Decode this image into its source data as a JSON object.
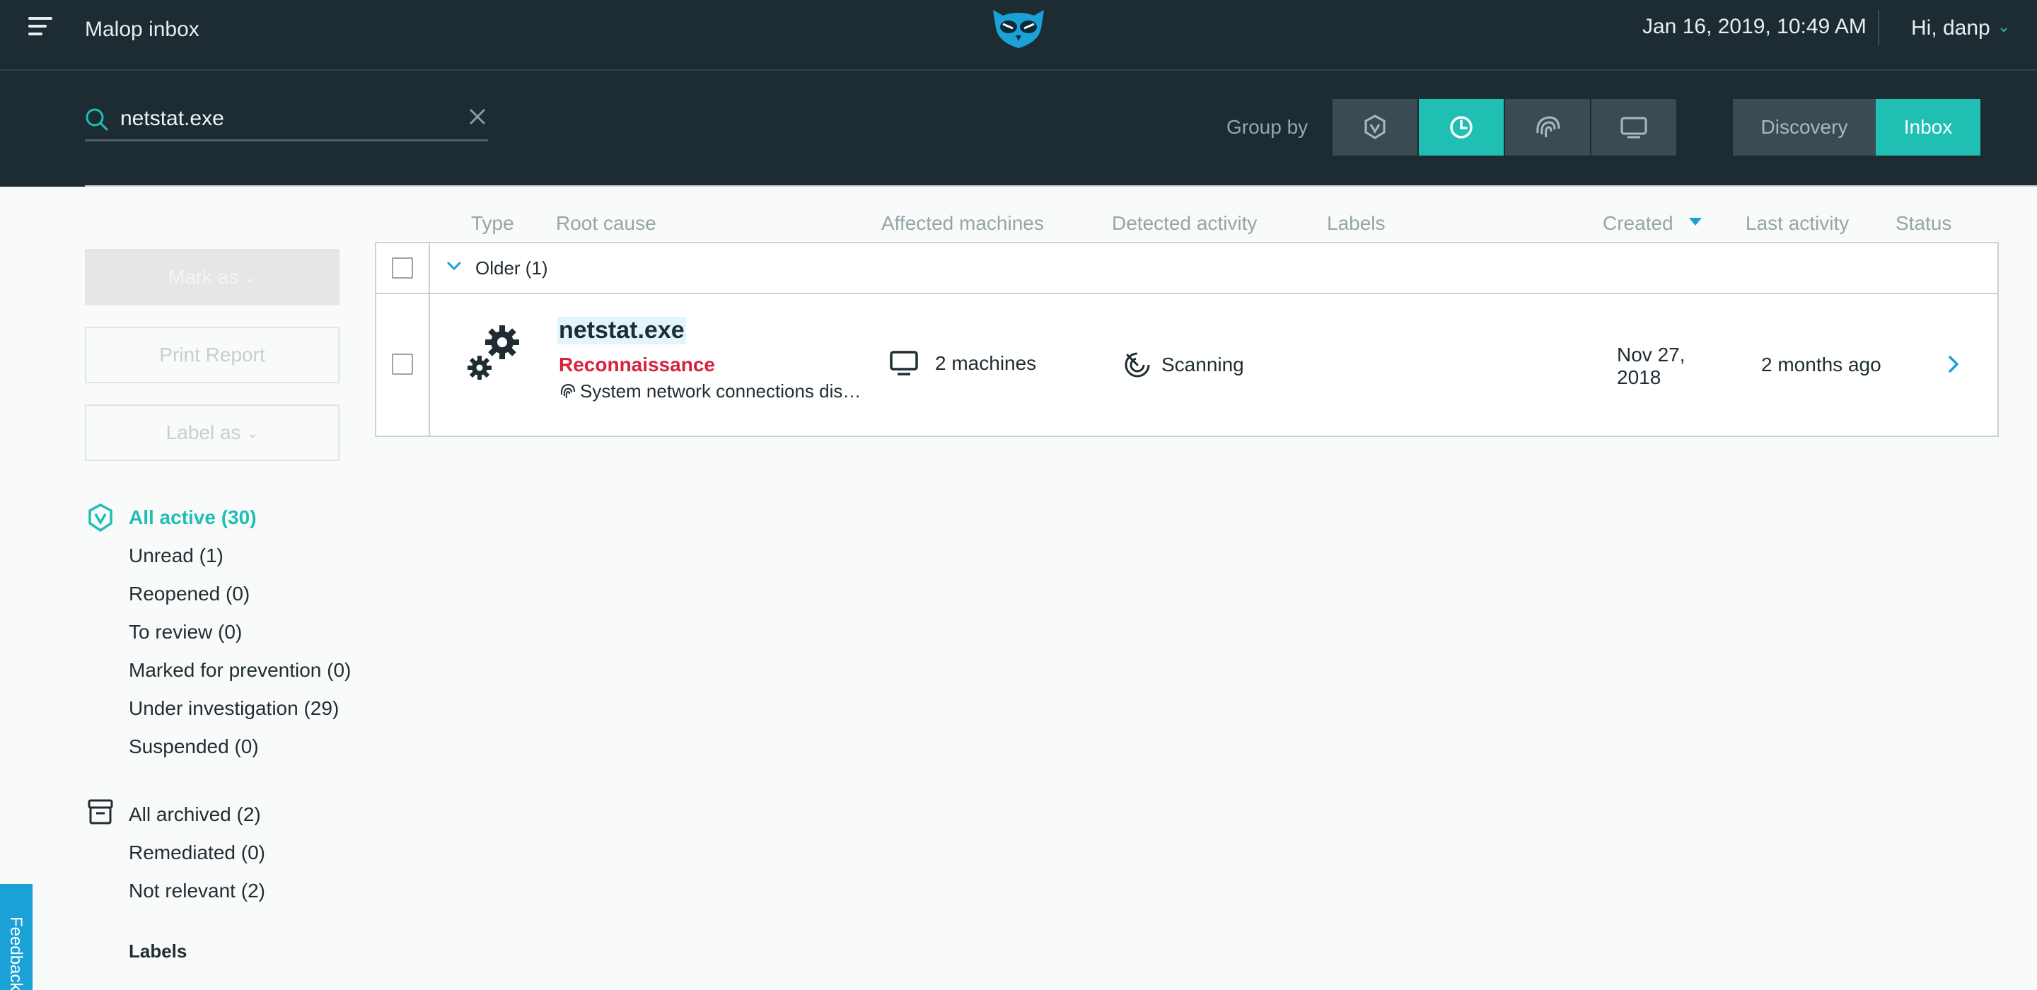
{
  "header": {
    "title": "Malop inbox",
    "datetime": "Jan 16, 2019, 10:49 AM",
    "user_greeting": "Hi, danp",
    "menu_icon": "hamburger-menu-icon",
    "logo": "owl-logo"
  },
  "search": {
    "value": "netstat.exe",
    "icon": "search-icon",
    "clear_icon": "close-icon"
  },
  "groupby": {
    "label": "Group by",
    "options": [
      {
        "icon": "malop-hex-icon",
        "active": false
      },
      {
        "icon": "clock-icon",
        "active": true
      },
      {
        "icon": "fingerprint-icon",
        "active": false
      },
      {
        "icon": "monitor-icon",
        "active": false
      }
    ]
  },
  "modes": {
    "discovery": "Discovery",
    "inbox": "Inbox",
    "active": "Inbox"
  },
  "actions": {
    "mark_as": "Mark as",
    "print_report": "Print Report",
    "label_as": "Label as"
  },
  "filters": {
    "active_group": [
      {
        "label": "All active  (30)",
        "active": true
      },
      {
        "label": "Unread (1)"
      },
      {
        "label": "Reopened (0)"
      },
      {
        "label": "To review (0)"
      },
      {
        "label": "Marked for prevention (0)"
      },
      {
        "label": "Under investigation (29)"
      },
      {
        "label": "Suspended (0)"
      }
    ],
    "archived_group": [
      {
        "label": "All archived  (2)"
      },
      {
        "label": "Remediated (0)"
      },
      {
        "label": "Not relevant (2)"
      }
    ],
    "labels_heading": "Labels"
  },
  "feedback": {
    "label": "Feedback"
  },
  "table": {
    "columns": [
      "Type",
      "Root cause",
      "Affected machines",
      "Detected activity",
      "Labels",
      "Created",
      "Last activity",
      "Status"
    ],
    "sorted_column": "Created",
    "group": {
      "label": "Older (1)"
    },
    "rows": [
      {
        "name": "netstat.exe",
        "category": "Reconnaissance",
        "description": "System network connections discovery",
        "machines": "2 machines",
        "activity": "Scanning",
        "created": "Nov 27, 2018",
        "last_activity": "2 months ago"
      }
    ]
  },
  "colors": {
    "header_bg": "#1d2c32",
    "accent": "#1fbfb4",
    "category_red": "#d9203e",
    "link_blue": "#1a9fd8"
  }
}
